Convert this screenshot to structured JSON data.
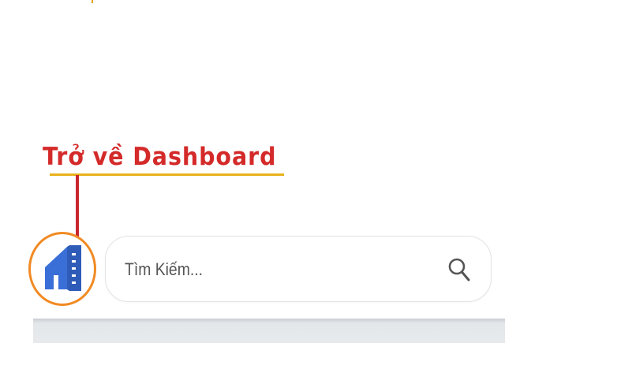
{
  "annotation": {
    "label": "Trở về Dashboard"
  },
  "header": {
    "home_button_icon": "home-building-icon",
    "search": {
      "placeholder": "Tìm Kiếm...",
      "value": "",
      "icon": "search-icon"
    }
  },
  "colors": {
    "annotation_text": "#d42a2a",
    "annotation_underline": "#e8b21b",
    "highlight_circle": "#f18a23",
    "home_icon_blue": "#3a6fd8",
    "search_border": "#e1e3e6",
    "toolbar_bar": "#e7eaed"
  }
}
